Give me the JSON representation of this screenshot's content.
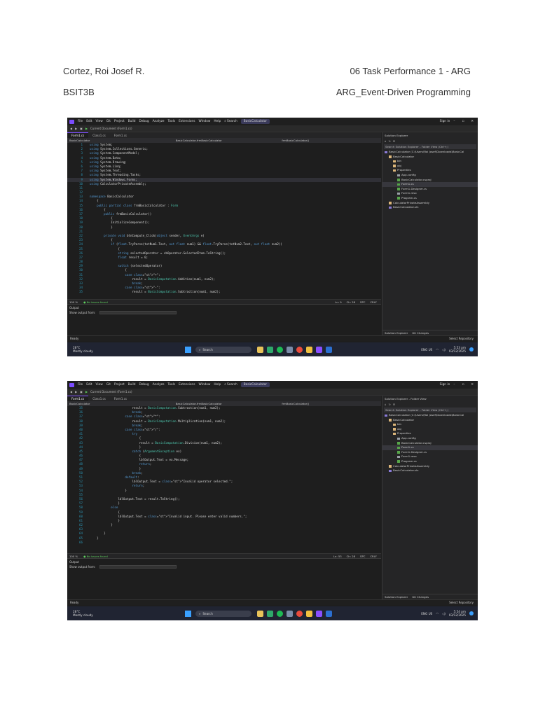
{
  "header": {
    "name": "Cortez, Roi Josef R.",
    "task": "06 Task Performance 1 - ARG",
    "section": "BSIT3B",
    "course": "ARG_Event-Driven Programming"
  },
  "ide": {
    "menu": [
      "File",
      "Edit",
      "View",
      "Git",
      "Project",
      "Build",
      "Debug",
      "Analyze",
      "Tools",
      "Extensions",
      "Window",
      "Help"
    ],
    "search_label": "Search",
    "solution_name": "BasicCalculator",
    "sign_in": "Sign in",
    "current_doc": "Current Document (Form1.cs)",
    "tabs": [
      "Form1.cs",
      "Class1.cs",
      "Form1.cs"
    ],
    "nav_left": "BasicCalculator",
    "nav_mid": "BasicCalculator.frmBasicCalculator",
    "nav_right": "frmBasicCalculator()",
    "status_zoom": "100 %",
    "status_issues": "No issues found",
    "status_pos1": "Ln: 9",
    "status_col1": "Ch: 28",
    "status_pos2": "Ln: 53",
    "status_col2": "Ch: 28",
    "status_spc": "SPC",
    "status_crlf": "CRLF",
    "output_title": "Output",
    "output_from": "Show output from:",
    "ready": "Ready",
    "select_repo": "Select Repository",
    "sidebar": {
      "title1": "Solution Explorer",
      "title2": "Solution Explorer - Folder View",
      "search": "Search Solution Explorer - Folder View (Ctrl+;)",
      "items": [
        "BasicCalculator (C:\\Users\\Roi Josef\\Downloads\\BasicCal",
        "BasicCalculator",
        "bin",
        "obj",
        "Properties",
        "App.config",
        "BasicCalculator.csproj",
        "Form1.cs",
        "Form1.Designer.cs",
        "Form1.resx",
        "Program.cs",
        "CalculatorPrivateAssembly",
        "BasicCalculator.sln"
      ],
      "bottom_a": "Solution Explorer",
      "bottom_b": "Git Changes"
    },
    "taskbar": {
      "temp": "28°C",
      "weather": "Mostly cloudy",
      "search": "Search",
      "lang": "ENG",
      "region": "US",
      "time1": "5:53 pm",
      "time2": "5:54 pm",
      "date": "03/12/2025"
    }
  },
  "code1": [
    {
      "n": "1",
      "t": "using System;"
    },
    {
      "n": "2",
      "t": "using System.Collections.Generic;"
    },
    {
      "n": "3",
      "t": "using System.ComponentModel;"
    },
    {
      "n": "4",
      "t": "using System.Data;"
    },
    {
      "n": "5",
      "t": "using System.Drawing;"
    },
    {
      "n": "6",
      "t": "using System.Linq;"
    },
    {
      "n": "7",
      "t": "using System.Text;"
    },
    {
      "n": "8",
      "t": "using System.Threading.Tasks;"
    },
    {
      "n": "9",
      "t": "using System.Windows.Forms;"
    },
    {
      "n": "10",
      "t": "using CalculatorPrivateAssembly;"
    },
    {
      "n": "11",
      "t": ""
    },
    {
      "n": "12",
      "t": ""
    },
    {
      "n": "13",
      "t": "namespace BasicCalculator"
    },
    {
      "n": "14",
      "t": "    {"
    },
    {
      "n": "15",
      "t": "    public partial class frmBasicCalculator : Form"
    },
    {
      "n": "16",
      "t": "        {"
    },
    {
      "n": "17",
      "t": "        public frmBasicCalculator()"
    },
    {
      "n": "18",
      "t": "            {"
    },
    {
      "n": "19",
      "t": "            InitializeComponent();"
    },
    {
      "n": "20",
      "t": "            }"
    },
    {
      "n": "21",
      "t": ""
    },
    {
      "n": "22",
      "t": "        private void btnCompute_Click(object sender, EventArgs e)"
    },
    {
      "n": "23",
      "t": "            {"
    },
    {
      "n": "24",
      "t": "            if (float.TryParse(txtNum1.Text, out float num1) && float.TryParse(txtNum2.Text, out float num2))"
    },
    {
      "n": "25",
      "t": "                {"
    },
    {
      "n": "26",
      "t": "                string selectedOperator = cbOperator.SelectedItem.ToString();"
    },
    {
      "n": "27",
      "t": "                float result = 0;"
    },
    {
      "n": "28",
      "t": ""
    },
    {
      "n": "29",
      "t": "                switch (selectedOperator)"
    },
    {
      "n": "30",
      "t": "                    {"
    },
    {
      "n": "31",
      "t": "                    case \"+\":"
    },
    {
      "n": "32",
      "t": "                        result = BasicComputation.Addition(num1, num2);"
    },
    {
      "n": "33",
      "t": "                        break;"
    },
    {
      "n": "34",
      "t": "                    case \"-\":"
    },
    {
      "n": "35",
      "t": "                        result = BasicComputation.Subtraction(num1, num2);"
    }
  ],
  "code2": [
    {
      "n": "35",
      "t": "                        result = BasicComputation.Subtraction(num1, num2);"
    },
    {
      "n": "36",
      "t": "                        break;"
    },
    {
      "n": "37",
      "t": "                    case \"*\":"
    },
    {
      "n": "38",
      "t": "                        result = BasicComputation.Multiplication(num1, num2);"
    },
    {
      "n": "39",
      "t": "                        break;"
    },
    {
      "n": "40",
      "t": "                    case \"/\":"
    },
    {
      "n": "41",
      "t": "                        try"
    },
    {
      "n": "42",
      "t": "                            {"
    },
    {
      "n": "43",
      "t": "                            result = BasicComputation.Division(num1, num2);"
    },
    {
      "n": "44",
      "t": "                            }"
    },
    {
      "n": "45",
      "t": "                        catch (ArgumentException ex)"
    },
    {
      "n": "46",
      "t": "                            {"
    },
    {
      "n": "47",
      "t": "                            lblOutput.Text = ex.Message;"
    },
    {
      "n": "48",
      "t": "                            return;"
    },
    {
      "n": "49",
      "t": "                            }"
    },
    {
      "n": "50",
      "t": "                        break;"
    },
    {
      "n": "51",
      "t": "                    default:"
    },
    {
      "n": "52",
      "t": "                        lblOutput.Text = \"Invalid operator selected.\";"
    },
    {
      "n": "53",
      "t": "                        return;"
    },
    {
      "n": "54",
      "t": "                    }"
    },
    {
      "n": "55",
      "t": ""
    },
    {
      "n": "56",
      "t": "                lblOutput.Text = result.ToString();"
    },
    {
      "n": "57",
      "t": "                }"
    },
    {
      "n": "58",
      "t": "            else"
    },
    {
      "n": "59",
      "t": "                {"
    },
    {
      "n": "60",
      "t": "                lblOutput.Text = \"Invalid input. Please enter valid numbers.\";"
    },
    {
      "n": "61",
      "t": "                }"
    },
    {
      "n": "62",
      "t": "            }"
    },
    {
      "n": "63",
      "t": ""
    },
    {
      "n": "64",
      "t": "        }"
    },
    {
      "n": "65",
      "t": "    }"
    },
    {
      "n": "66",
      "t": ""
    }
  ]
}
